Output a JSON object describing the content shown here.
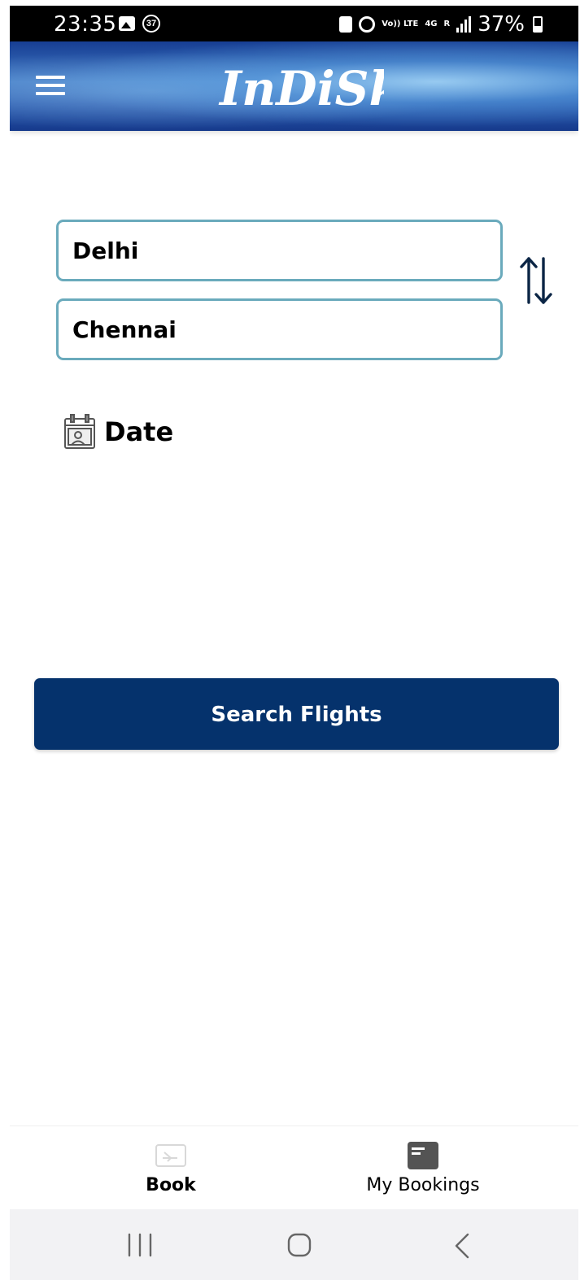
{
  "status_bar": {
    "time": "23:35",
    "notification_count": "37",
    "network_volte": "Vo)) LTE",
    "network_type": "4G",
    "roaming": "R",
    "battery_percent": "37%"
  },
  "app_bar": {
    "brand": "InDiSky",
    "menu_icon": "hamburger-menu-icon"
  },
  "search_form": {
    "from_city": "Delhi",
    "to_city": "Chennai",
    "swap_icon": "swap-vertical-icon",
    "date_label": "Date",
    "date_icon": "calendar-icon",
    "search_label": "Search Flights"
  },
  "bottom_nav": {
    "items": [
      {
        "label": "Book",
        "icon": "flight-ticket-icon",
        "active": true
      },
      {
        "label": "My Bookings",
        "icon": "bookings-card-icon",
        "active": false
      }
    ]
  },
  "system_nav": {
    "recents_icon": "recents-icon",
    "home_icon": "home-icon",
    "back_icon": "back-icon"
  },
  "colors": {
    "primary": "#05326c",
    "input_border": "#6aaabc",
    "status_bar": "#000000",
    "app_bar_blue": "#2a5aae",
    "system_nav_bg": "#f2f2f4"
  }
}
